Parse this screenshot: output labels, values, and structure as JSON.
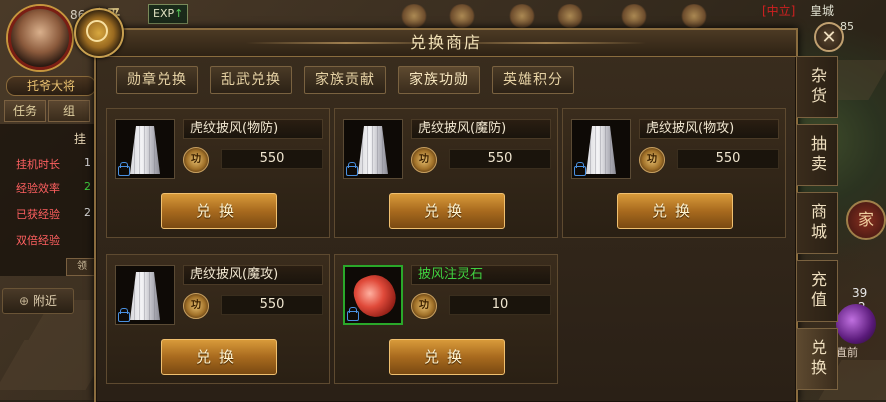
{
  "hud": {
    "level": "86",
    "nickname": "托爷大将",
    "tabs": [
      "任务",
      "组"
    ],
    "stats": [
      {
        "label": "挂机时长",
        "value": "1",
        "color": "#d8d8d8"
      },
      {
        "label": "经验效率",
        "value": "2",
        "color": "#40d040"
      },
      {
        "label": "已获经验",
        "value": "2",
        "color": "#d8d8d8"
      },
      {
        "label": "双倍经验",
        "value": "",
        "color": "#d83030"
      }
    ],
    "hang_label": "挂",
    "small_button": "领",
    "nearby_label": "附近",
    "nearby_icon": "crosshair-icon"
  },
  "topbar": {
    "peace_mode": "和平",
    "exp_label": "EXP",
    "server_tag": "[中立]",
    "city": "皇城",
    "coord": "85"
  },
  "right_hud": {
    "clan_label": "家",
    "num_a": "39",
    "num_b": "2",
    "orb_label": "直前"
  },
  "shop": {
    "title": "兑换商店",
    "close_icon": "close-icon",
    "tabs": [
      {
        "label": "勋章兑换",
        "active": false
      },
      {
        "label": "乱武兑换",
        "active": false
      },
      {
        "label": "家族贡献",
        "active": false
      },
      {
        "label": "家族功勋",
        "active": true
      },
      {
        "label": "英雄积分",
        "active": false
      }
    ],
    "items": [
      {
        "name": "虎纹披风(物防)",
        "price": "550",
        "icon": "cloak-icon",
        "name_color": "#f0e6d0",
        "currency": "功",
        "button": "兑换"
      },
      {
        "name": "虎纹披风(魔防)",
        "price": "550",
        "icon": "cloak-icon",
        "name_color": "#f0e6d0",
        "currency": "功",
        "button": "兑换"
      },
      {
        "name": "虎纹披风(物攻)",
        "price": "550",
        "icon": "cloak-icon",
        "name_color": "#f0e6d0",
        "currency": "功",
        "button": "兑换"
      },
      {
        "name": "虎纹披风(魔攻)",
        "price": "550",
        "icon": "cloak-icon",
        "name_color": "#f0e6d0",
        "currency": "功",
        "button": "兑换"
      },
      {
        "name": "披风注灵石",
        "price": "10",
        "icon": "gem-icon",
        "name_color": "#40d040",
        "currency": "功",
        "button": "兑换"
      }
    ],
    "side_tabs": [
      {
        "label": "杂货",
        "active": false
      },
      {
        "label": "抽卖",
        "active": false
      },
      {
        "label": "商城",
        "active": false
      },
      {
        "label": "充值",
        "active": false
      },
      {
        "label": "兑换",
        "active": true
      }
    ]
  }
}
